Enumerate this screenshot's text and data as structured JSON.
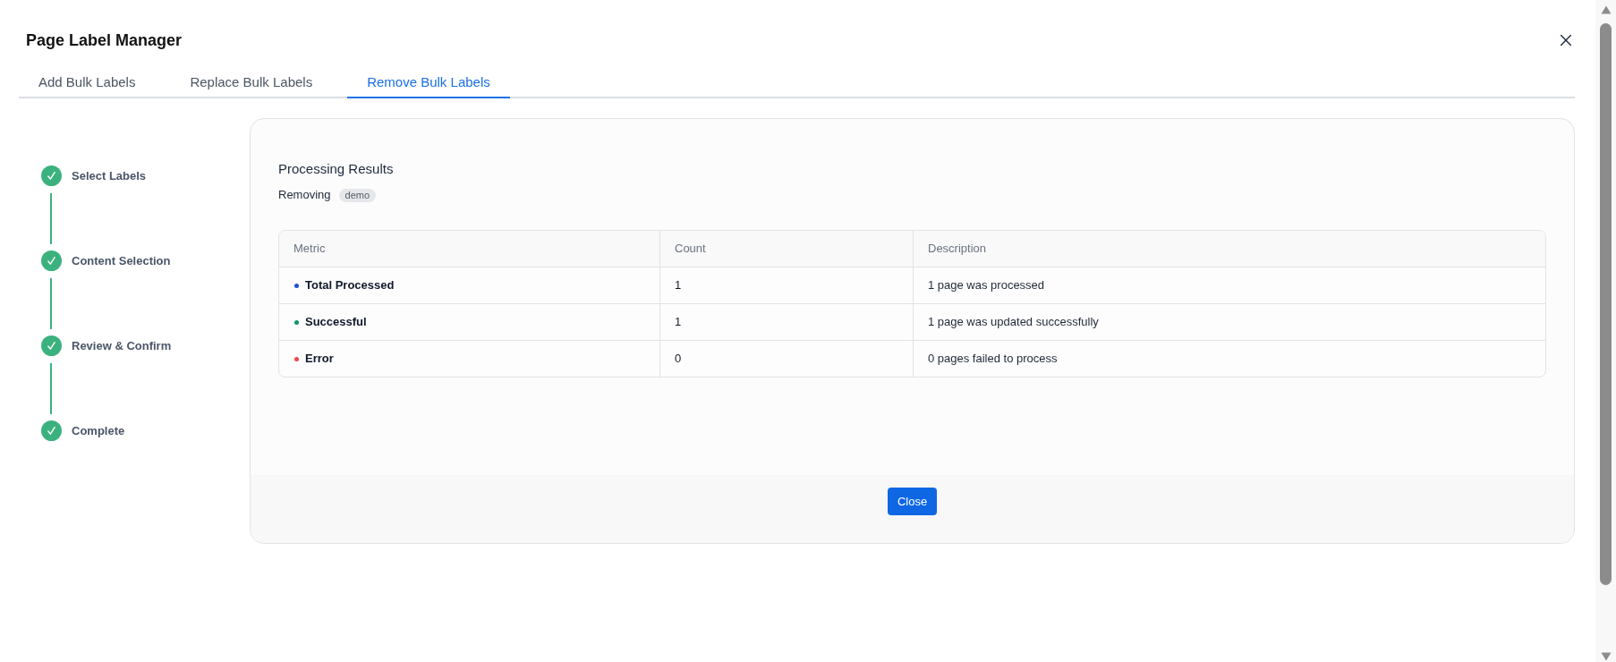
{
  "dialog": {
    "title": "Page Label Manager"
  },
  "tabs": [
    {
      "label": "Add Bulk Labels",
      "selected": false
    },
    {
      "label": "Replace Bulk Labels",
      "selected": false
    },
    {
      "label": "Remove Bulk Labels",
      "selected": true
    }
  ],
  "steps": [
    {
      "label": "Select Labels",
      "completed": true
    },
    {
      "label": "Content Selection",
      "completed": true
    },
    {
      "label": "Review & Confirm",
      "completed": true
    },
    {
      "label": "Complete",
      "completed": true
    }
  ],
  "results": {
    "title": "Processing Results",
    "action": "Removing",
    "tag": "demo",
    "table": {
      "columns": [
        "Metric",
        "Count",
        "Description"
      ],
      "rows": [
        {
          "metric": "Total Processed",
          "color": "#1e4fd6",
          "count": "1",
          "description": "1 page was processed"
        },
        {
          "metric": "Successful",
          "color": "#10936a",
          "count": "1",
          "description": "1 page was updated successfully"
        },
        {
          "metric": "Error",
          "color": "#f04545",
          "count": "0",
          "description": "0 pages failed to process"
        }
      ]
    }
  },
  "footer": {
    "button": "Close"
  }
}
